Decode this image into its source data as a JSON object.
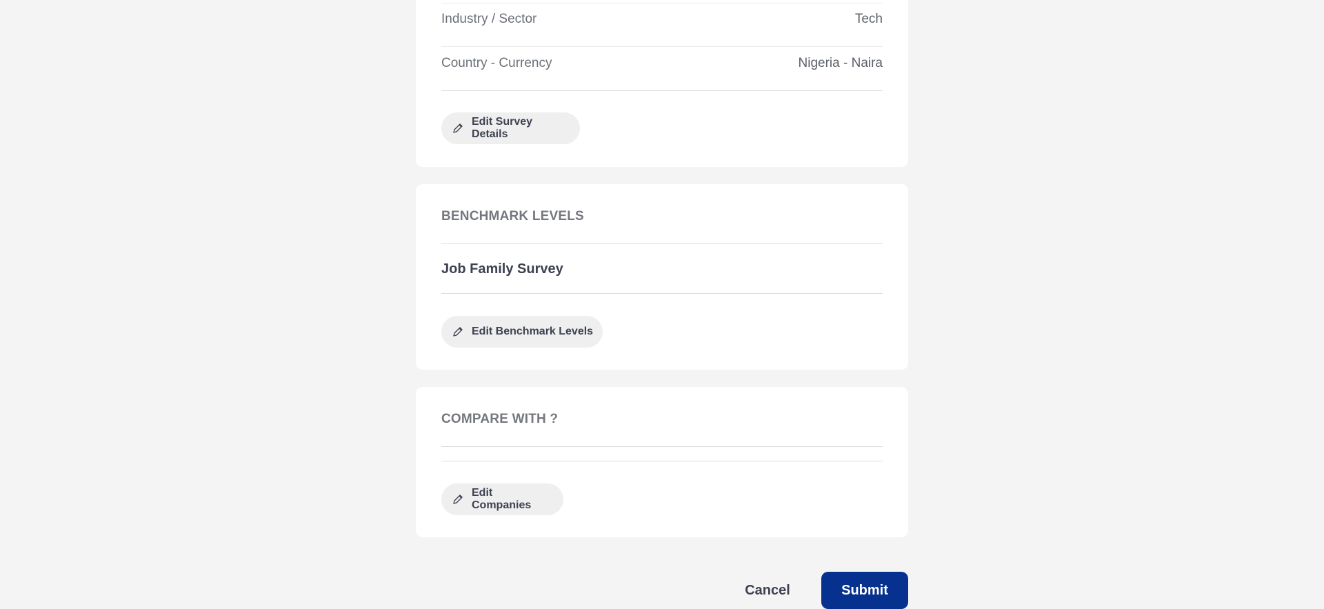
{
  "survey_details": {
    "rows": [
      {
        "label": "Industry / Sector",
        "value": "Tech"
      },
      {
        "label": "Country - Currency",
        "value": "Nigeria - Naira"
      }
    ],
    "edit_label": "Edit Survey Details"
  },
  "benchmark_levels": {
    "title": "BENCHMARK LEVELS",
    "survey_name": "Job Family Survey",
    "edit_label": "Edit Benchmark Levels"
  },
  "compare_with": {
    "title": "COMPARE WITH ?",
    "edit_label": "Edit Companies"
  },
  "actions": {
    "cancel_label": "Cancel",
    "submit_label": "Submit"
  },
  "colors": {
    "background": "#f4f4f4",
    "primary": "#06318f",
    "pill": "#efefef"
  },
  "icons": {
    "edit": "pencil-icon"
  }
}
